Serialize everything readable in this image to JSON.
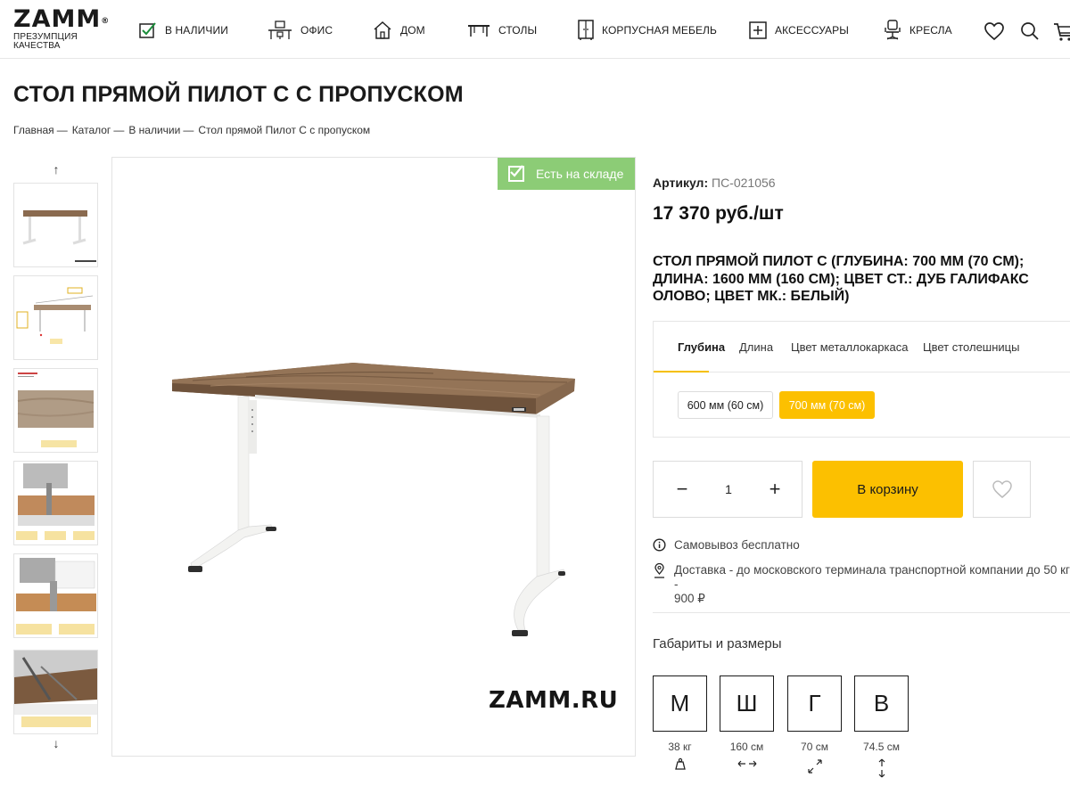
{
  "header": {
    "logo": "ZAMM",
    "logo_mark": "®",
    "tagline": "ПРЕЗУМПЦИЯ КАЧЕСТВА",
    "nav": [
      {
        "label": "В НАЛИЧИИ",
        "icon": "checkbox-icon"
      },
      {
        "label": "ОФИС",
        "icon": "office-icon"
      },
      {
        "label": "ДОМ",
        "icon": "house-icon"
      },
      {
        "label": "СТОЛЫ",
        "icon": "table-icon"
      },
      {
        "label": "КОРПУСНАЯ МЕБЕЛЬ",
        "icon": "cabinet-icon"
      },
      {
        "label": "АКСЕССУАРЫ",
        "icon": "plus-box-icon"
      },
      {
        "label": "КРЕСЛА",
        "icon": "chair-icon"
      }
    ]
  },
  "page": {
    "title": "СТОЛ ПРЯМОЙ ПИЛОТ С С ПРОПУСКОМ",
    "breadcrumb": [
      "Главная",
      "Каталог",
      "В наличии",
      "Стол прямой Пилот С с пропуском"
    ],
    "breadcrumb_sep": "—"
  },
  "gallery": {
    "up_arrow": "↑",
    "down_arrow": "↓",
    "stock_badge": "Есть на складе",
    "watermark": "ZAMM.RU",
    "thumb_count": 6
  },
  "product": {
    "article_label": "Артикул:",
    "article_value": "ПС-021056",
    "price": "17 370 руб./шт",
    "name": "СТОЛ ПРЯМОЙ ПИЛОТ С (ГЛУБИНА: 700 ММ (70 СМ); ДЛИНА: 1600 ММ (160 СМ); ЦВЕТ СТ.: ДУБ ГАЛИФАКС ОЛОВО; ЦВЕТ МК.: БЕЛЫЙ)",
    "tabs": [
      "Глубина",
      "Длина",
      "Цвет металлокаркаса",
      "Цвет столешницы"
    ],
    "active_tab": "Глубина",
    "options": [
      {
        "label": "600 мм (60 см)",
        "selected": false
      },
      {
        "label": "700 мм (70 см)",
        "selected": true
      }
    ],
    "quantity": "1",
    "minus": "−",
    "plus": "+",
    "cart_label": "В корзину",
    "pickup": "Самовывоз бесплатно",
    "delivery_line1": "Доставка - до московского терминала транспортной компании до 50 кг -",
    "delivery_line2": "900 ₽",
    "dims_title": "Габариты и размеры",
    "dims": [
      {
        "letter": "М",
        "value": "38 кг",
        "icon": "weight-icon"
      },
      {
        "letter": "Ш",
        "value": "160 см",
        "icon": "width-arrows-icon"
      },
      {
        "letter": "Г",
        "value": "70 см",
        "icon": "depth-arrows-icon"
      },
      {
        "letter": "В",
        "value": "74.5 см",
        "icon": "height-arrows-icon"
      }
    ]
  },
  "colors": {
    "accent": "#fcc000",
    "stock_green": "#8ccc76",
    "tabletop_wood": "#8a6a4f",
    "frame_white": "#f3f3f1"
  }
}
